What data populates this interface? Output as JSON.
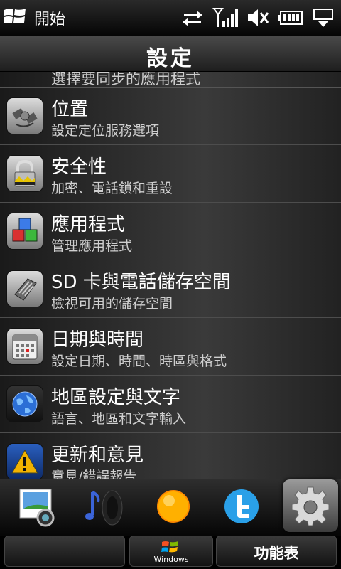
{
  "statusbar": {
    "start_label": "開始",
    "icons": [
      "windows-flag-icon",
      "data-transfer-icon",
      "signal-strength-icon",
      "speaker-muted-icon",
      "battery-icon",
      "connectivity-icon"
    ]
  },
  "header": {
    "title": "設定"
  },
  "list": {
    "partial_top_text": "選擇要同步的應用程式",
    "items": [
      {
        "title": "位置",
        "subtitle": "設定定位服務選項",
        "icon": "satellite-icon"
      },
      {
        "title": "安全性",
        "subtitle": "加密、電話鎖和重設",
        "icon": "padlock-icon"
      },
      {
        "title": "應用程式",
        "subtitle": "管理應用程式",
        "icon": "app-cubes-icon"
      },
      {
        "title": "SD 卡與電話儲存空間",
        "subtitle": "檢視可用的儲存空間",
        "icon": "memory-card-icon"
      },
      {
        "title": "日期與時間",
        "subtitle": "設定日期、時間、時區與格式",
        "icon": "calendar-icon"
      },
      {
        "title": "地區設定與文字",
        "subtitle": "語言、地區和文字輸入",
        "icon": "globe-icon"
      },
      {
        "title": "更新和意見",
        "subtitle": "意見/錯誤報告",
        "icon": "warning-icon"
      }
    ]
  },
  "dock": {
    "items": [
      "photos-camera-icon",
      "music-speaker-icon",
      "weather-sun-icon",
      "twitter-icon",
      "settings-gear-icon"
    ],
    "selected": "settings-gear-icon"
  },
  "softkeys": {
    "left_label": "",
    "windows_label": "Windows",
    "right_label": "功能表"
  },
  "colors": {
    "background": "#000000",
    "text": "#ffffff",
    "subtext": "#cfcfcf"
  }
}
